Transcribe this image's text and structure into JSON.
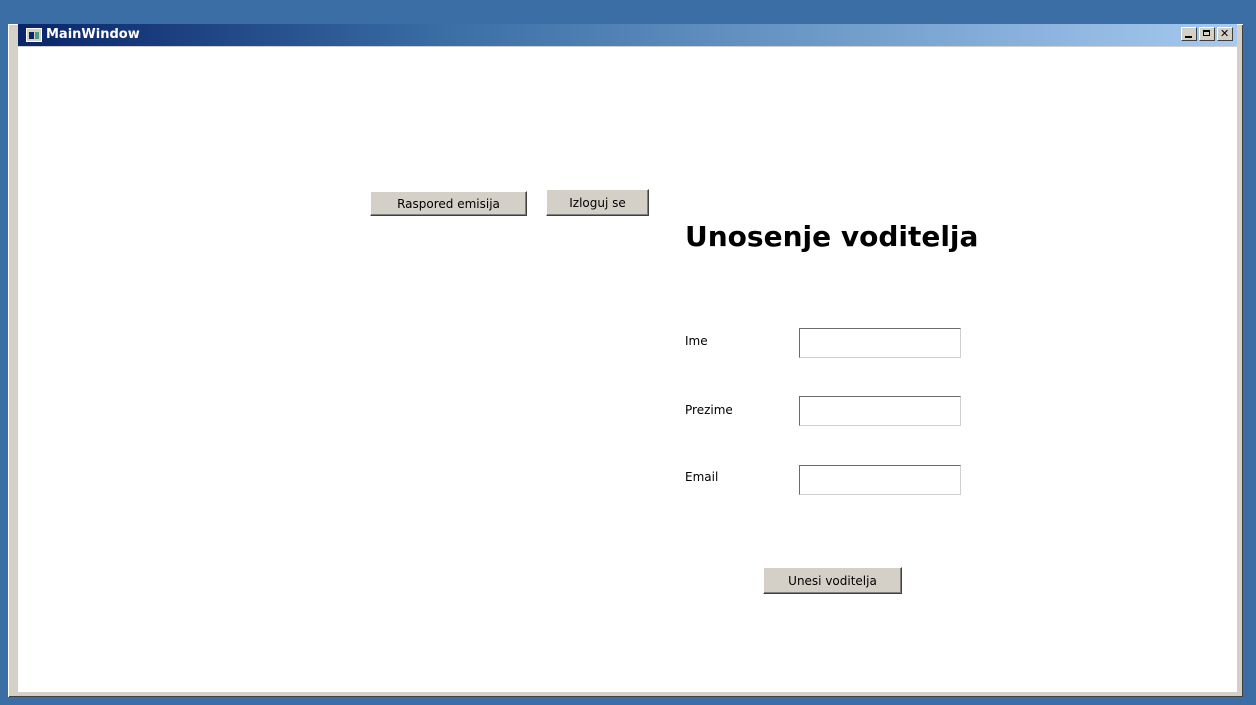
{
  "window": {
    "title": "MainWindow"
  },
  "toolbar": {
    "schedule_label": "Raspored emisija",
    "logout_label": "Izloguj se"
  },
  "form": {
    "heading": "Unosenje voditelja",
    "fields": [
      {
        "label": "Ime",
        "value": ""
      },
      {
        "label": "Prezime",
        "value": ""
      },
      {
        "label": "Email",
        "value": ""
      }
    ],
    "submit_label": "Unesi voditelja"
  }
}
